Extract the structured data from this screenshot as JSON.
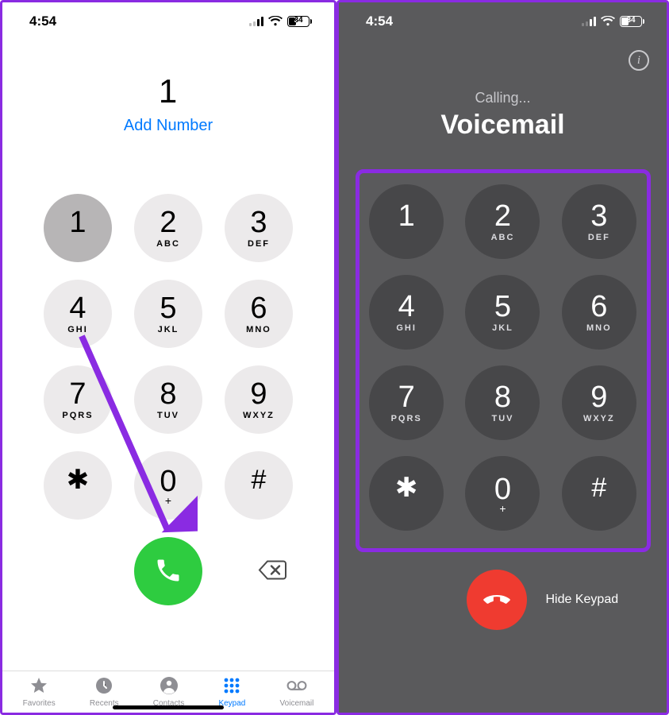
{
  "status": {
    "time": "4:54",
    "battery_pct": "34"
  },
  "left": {
    "typed_number": "1",
    "add_number_label": "Add Number",
    "keys": {
      "k1": {
        "digit": "1",
        "letters": ""
      },
      "k2": {
        "digit": "2",
        "letters": "ABC"
      },
      "k3": {
        "digit": "3",
        "letters": "DEF"
      },
      "k4": {
        "digit": "4",
        "letters": "GHI"
      },
      "k5": {
        "digit": "5",
        "letters": "JKL"
      },
      "k6": {
        "digit": "6",
        "letters": "MNO"
      },
      "k7": {
        "digit": "7",
        "letters": "PQRS"
      },
      "k8": {
        "digit": "8",
        "letters": "TUV"
      },
      "k9": {
        "digit": "9",
        "letters": "WXYZ"
      },
      "kstar": {
        "digit": "✱",
        "letters": ""
      },
      "k0": {
        "digit": "0",
        "plus": "+"
      },
      "khash": {
        "digit": "#",
        "letters": ""
      }
    },
    "tabs": {
      "favorites": "Favorites",
      "recents": "Recents",
      "contacts": "Contacts",
      "keypad": "Keypad",
      "voicemail": "Voicemail"
    }
  },
  "right": {
    "status_text": "Calling...",
    "callee_name": "Voicemail",
    "hide_keypad_label": "Hide Keypad",
    "keys": {
      "k1": {
        "digit": "1",
        "letters": ""
      },
      "k2": {
        "digit": "2",
        "letters": "ABC"
      },
      "k3": {
        "digit": "3",
        "letters": "DEF"
      },
      "k4": {
        "digit": "4",
        "letters": "GHI"
      },
      "k5": {
        "digit": "5",
        "letters": "JKL"
      },
      "k6": {
        "digit": "6",
        "letters": "MNO"
      },
      "k7": {
        "digit": "7",
        "letters": "PQRS"
      },
      "k8": {
        "digit": "8",
        "letters": "TUV"
      },
      "k9": {
        "digit": "9",
        "letters": "WXYZ"
      },
      "kstar": {
        "digit": "✱",
        "letters": ""
      },
      "k0": {
        "digit": "0",
        "plus": "+"
      },
      "khash": {
        "digit": "#",
        "letters": ""
      }
    }
  },
  "colors": {
    "accent_purple": "#8a2be2",
    "ios_blue": "#007aff",
    "call_green": "#2ecc40",
    "end_red": "#ef3b30"
  }
}
